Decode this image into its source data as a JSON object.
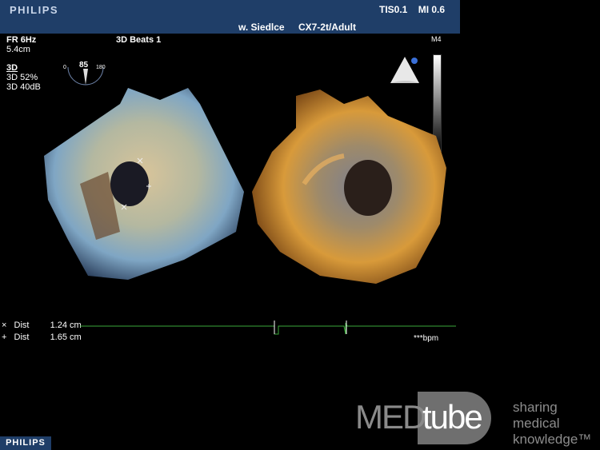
{
  "header": {
    "brand": "PHILIPS",
    "tis": "TIS0.1",
    "mi": "MI 0.6",
    "hospital": "w. Siedlce",
    "probe_preset": "CX7-2t/Adult"
  },
  "left_panel": {
    "fr": "FR 6Hz",
    "depth": "5.4cm",
    "mode": "3D",
    "gain": "3D 52%",
    "compress": "3D 40dB",
    "beats": "3D Beats 1"
  },
  "dial": {
    "min": "0",
    "value": "85",
    "max": "180"
  },
  "grayscale_map": "M4",
  "measurements": [
    {
      "symbol": "×",
      "label": "Dist",
      "value": "1.24 cm"
    },
    {
      "symbol": "+",
      "label": "Dist",
      "value": "1.65 cm"
    }
  ],
  "ecg": {
    "bpm": "***bpm",
    "color": "#3aa83a"
  },
  "footer": {
    "brand": "PHILIPS"
  },
  "watermark": {
    "med": "MED",
    "tube": "tube",
    "tagline": [
      "sharing",
      "medical",
      "knowledge™"
    ]
  },
  "colors": {
    "header_bg": "#1f3e68",
    "left_render": "#9fb6c6",
    "right_render": "#b8741e"
  }
}
